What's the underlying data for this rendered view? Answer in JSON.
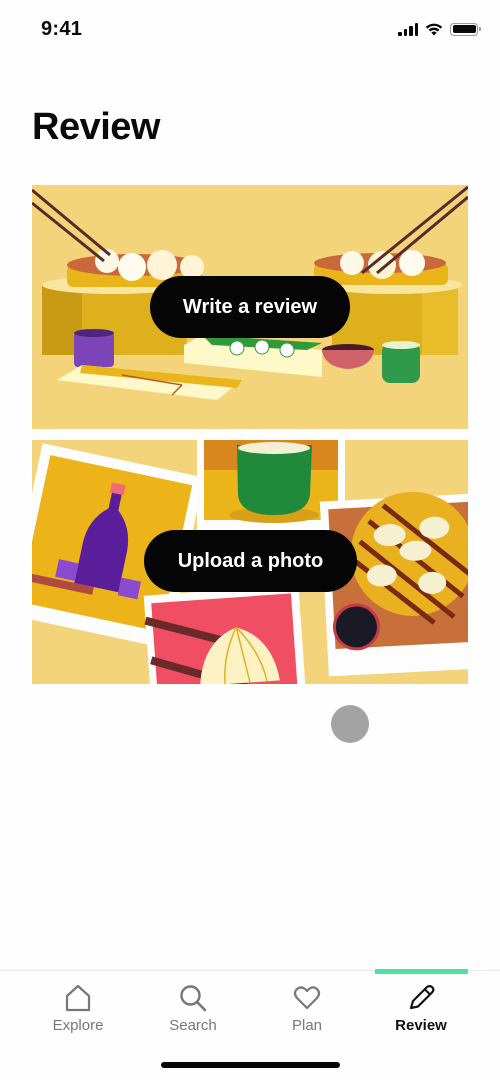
{
  "status_bar": {
    "time": "9:41",
    "icons": [
      "cellular-signal-icon",
      "wifi-icon",
      "battery-icon"
    ]
  },
  "header": {
    "title": "Review"
  },
  "cards": [
    {
      "id": "write-review",
      "button_label": "Write a review",
      "illustration": "dim-sum-table-illustration"
    },
    {
      "id": "upload-photo",
      "button_label": "Upload a photo",
      "illustration": "food-photos-collage-illustration"
    }
  ],
  "tab_bar": {
    "accent_color": "#4de2a0",
    "active_tab": "Review",
    "tabs": [
      {
        "label": "Explore",
        "icon": "home-icon"
      },
      {
        "label": "Search",
        "icon": "search-icon"
      },
      {
        "label": "Plan",
        "icon": "heart-icon"
      },
      {
        "label": "Review",
        "icon": "pencil-icon"
      }
    ]
  }
}
